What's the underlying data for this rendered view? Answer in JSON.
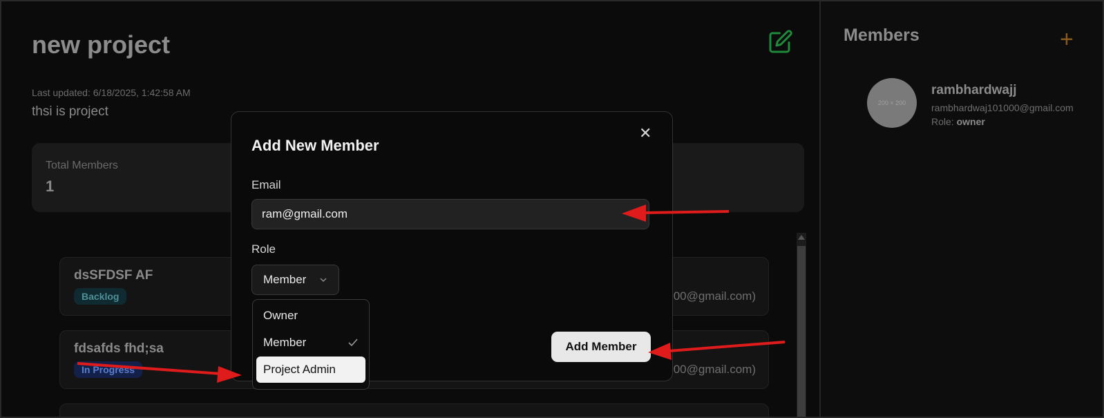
{
  "project": {
    "title": "new project",
    "last_updated": "Last updated: 6/18/2025, 1:42:58 AM",
    "description": "thsi is project",
    "edit_icon": "edit-icon"
  },
  "stats": {
    "total_members_label": "Total Members",
    "total_members_value": "1"
  },
  "tasks": [
    {
      "title": "dsSFDSF AF",
      "status": "Backlog",
      "assignee_email_fragment": "00@gmail.com)"
    },
    {
      "title": "fdsafds fhd;sa",
      "status": "In Progress",
      "assignee_email_fragment": "00@gmail.com)"
    }
  ],
  "sidebar": {
    "title": "Members",
    "add_icon": "plus-icon",
    "members": [
      {
        "avatar_text": "200 × 200",
        "name": "rambhardwajj",
        "email": "rambhardwaj101000@gmail.com",
        "role_label": "Role: ",
        "role": "owner"
      }
    ]
  },
  "modal": {
    "title": "Add New Member",
    "close_icon": "close-icon",
    "email_label": "Email",
    "email_value": "ram@gmail.com",
    "role_label": "Role",
    "role_selected": "Member",
    "submit_label": "Add Member",
    "role_options": [
      {
        "label": "Owner",
        "checked": false,
        "highlighted": false
      },
      {
        "label": "Member",
        "checked": true,
        "highlighted": false
      },
      {
        "label": "Project Admin",
        "checked": false,
        "highlighted": true
      }
    ]
  },
  "colors": {
    "background": "#0b0b0b",
    "modal_bg": "#0a0a0a",
    "edit_icon": "#1f8a3a",
    "add_plus": "#8a5a1c",
    "annotation_arrow": "#e01b1b",
    "backlog_badge": "#0f2a30",
    "in_progress_badge": "#13214a"
  }
}
